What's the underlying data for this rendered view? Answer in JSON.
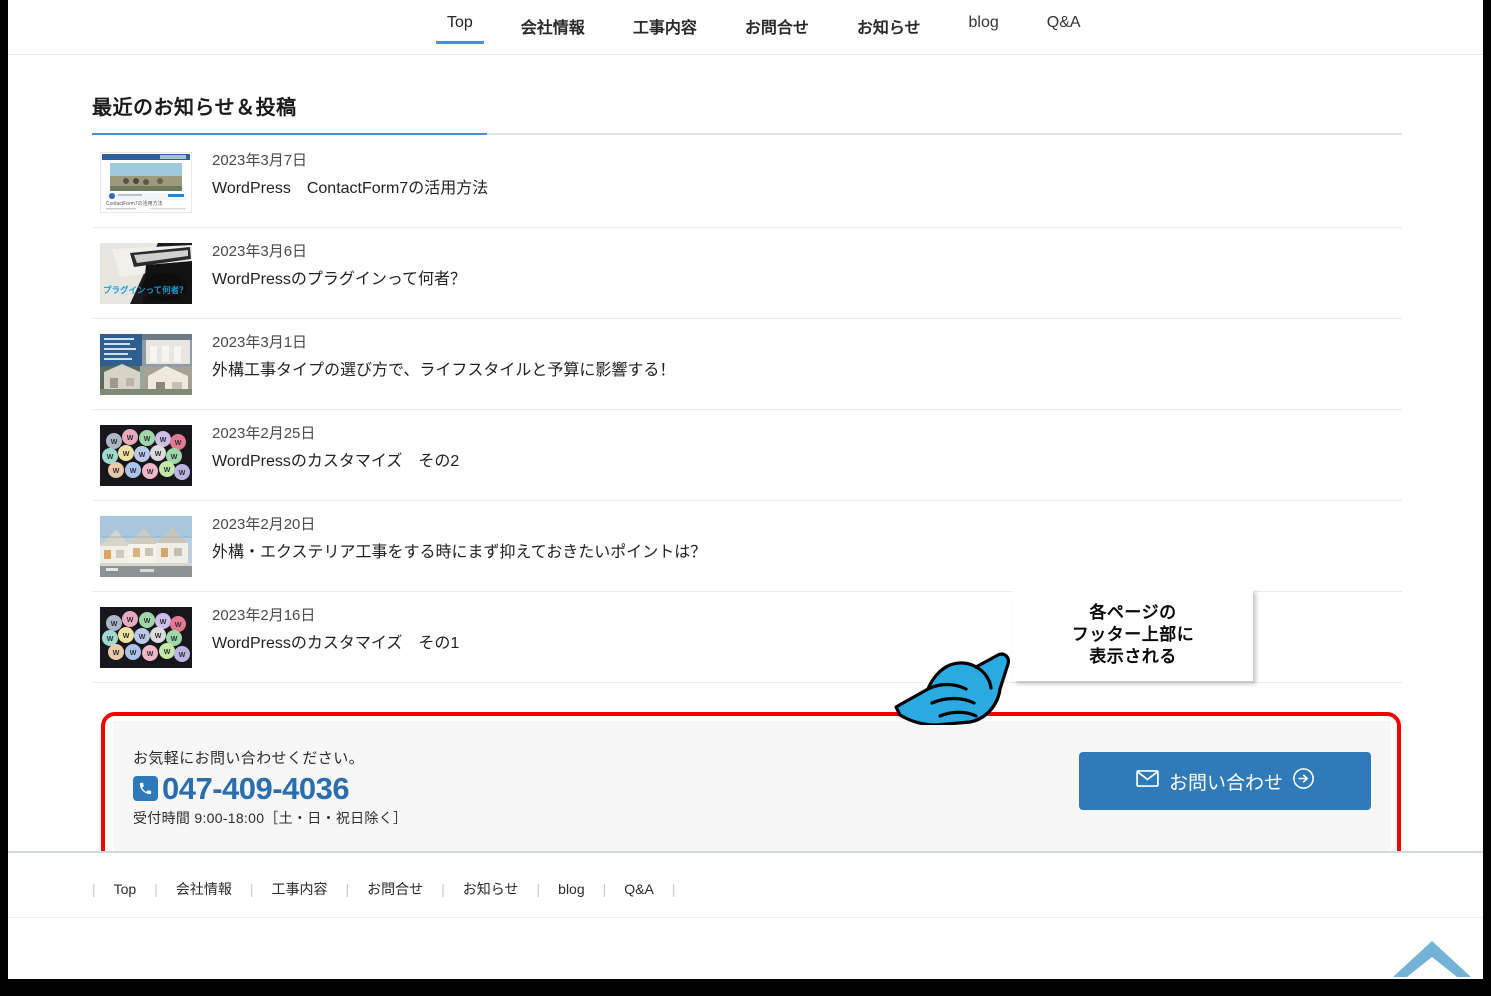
{
  "nav": {
    "items": [
      {
        "label": "Top",
        "active": true,
        "weight": "light"
      },
      {
        "label": "会社情報",
        "active": false,
        "weight": "bold"
      },
      {
        "label": "工事内容",
        "active": false,
        "weight": "bold"
      },
      {
        "label": "お問合せ",
        "active": false,
        "weight": "bold"
      },
      {
        "label": "お知らせ",
        "active": false,
        "weight": "bold"
      },
      {
        "label": "blog",
        "active": false,
        "weight": "light"
      },
      {
        "label": "Q&A",
        "active": false,
        "weight": "light"
      }
    ]
  },
  "section": {
    "title": "最近のお知らせ＆投稿"
  },
  "posts": [
    {
      "date": "2023年3月7日",
      "title": "WordPress　ContactForm7の活用方法",
      "thumb": "screenshot-contactform-article"
    },
    {
      "date": "2023年3月6日",
      "title": "WordPressのプラグインって何者？",
      "thumb": "photo-pen-and-paper-dark"
    },
    {
      "date": "2023年3月1日",
      "title": "外構工事タイプの選び方で、ライフスタイルと予算に影響する！",
      "thumb": "photo-exterior-house-collage"
    },
    {
      "date": "2023年2月25日",
      "title": "WordPressのカスタマイズ　その2",
      "thumb": "photo-wordpress-badges"
    },
    {
      "date": "2023年2月20日",
      "title": "外構・エクステリア工事をする時にまず抑えておきたいポイントは？",
      "thumb": "photo-housing-street"
    },
    {
      "date": "2023年2月16日",
      "title": "WordPressのカスタマイズ　その1",
      "thumb": "photo-wordpress-badges"
    }
  ],
  "cta": {
    "lead": "お気軽にお問い合わせください。",
    "phone": "047-409-4036",
    "hours": "受付時間 9:00-18:00［土・日・祝日除く］",
    "button_label": "お問い合わせ",
    "phone_icon": "phone-icon",
    "mail_icon": "mail-icon",
    "arrow_icon": "arrow-right-circle-icon"
  },
  "callout": {
    "text": "各ページの\nフッター上部に\n表示される",
    "pointer_icon": "pointing-hand-icon"
  },
  "footer": {
    "links": [
      "Top",
      "会社情報",
      "工事内容",
      "お問合せ",
      "お知らせ",
      "blog",
      "Q&A"
    ],
    "back_to_top_icon": "chevron-up-icon"
  },
  "colors": {
    "accent_blue": "#4e8ed0",
    "button_blue": "#2f7ab8",
    "phone_blue": "#2b6eae",
    "highlight_red": "#f60000",
    "hand_cyan": "#29ABE2",
    "backtotop_blue": "#74b3d6"
  }
}
